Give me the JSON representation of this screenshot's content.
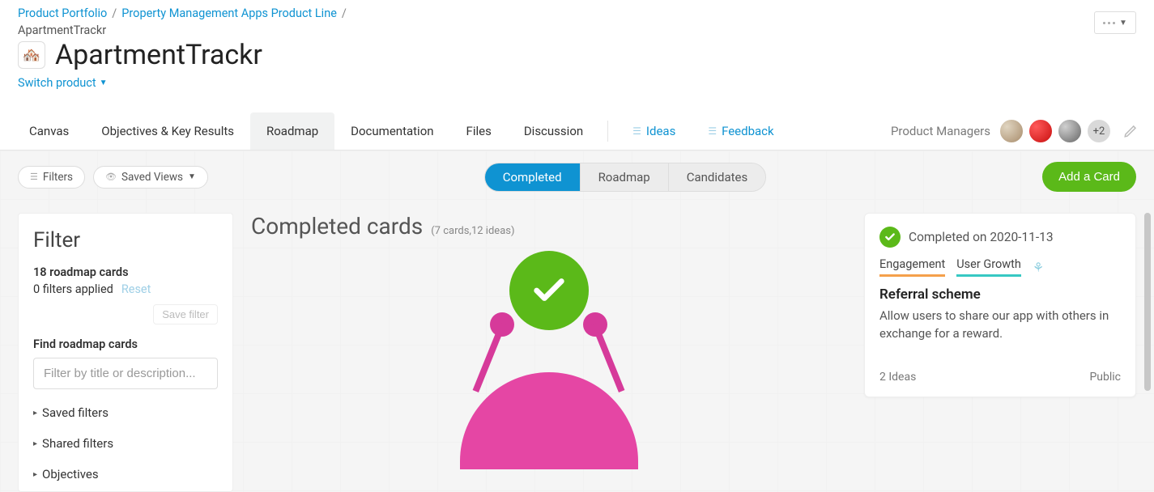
{
  "breadcrumb": {
    "portfolio": "Product Portfolio",
    "line": "Property Management Apps Product Line",
    "current": "ApartmentTrackr"
  },
  "title": "ApartmentTrackr",
  "switch_product": "Switch product",
  "tabs": {
    "canvas": "Canvas",
    "okr": "Objectives & Key Results",
    "roadmap": "Roadmap",
    "documentation": "Documentation",
    "files": "Files",
    "discussion": "Discussion",
    "ideas": "Ideas",
    "feedback": "Feedback"
  },
  "pm_label": "Product Managers",
  "avatar_more": "+2",
  "toolbar": {
    "filters": "Filters",
    "saved_views": "Saved Views",
    "completed": "Completed",
    "roadmap": "Roadmap",
    "candidates": "Candidates",
    "add_card": "Add a Card"
  },
  "filter_panel": {
    "heading": "Filter",
    "count_line": "18 roadmap cards",
    "applied_line": "0 filters applied",
    "reset": "Reset",
    "save_filter": "Save filter",
    "find_label": "Find roadmap cards",
    "placeholder": "Filter by title or description...",
    "saved_filters": "Saved filters",
    "shared_filters": "Shared filters",
    "objectives": "Objectives"
  },
  "center": {
    "heading": "Completed cards",
    "sub": "(7 cards,12 ideas)"
  },
  "card": {
    "completed_on": "Completed on 2020-11-13",
    "tag_engagement": "Engagement",
    "tag_growth": "User Growth",
    "title": "Referral scheme",
    "desc": "Allow users to share our app with others in exchange for a reward.",
    "ideas": "2 Ideas",
    "visibility": "Public"
  }
}
